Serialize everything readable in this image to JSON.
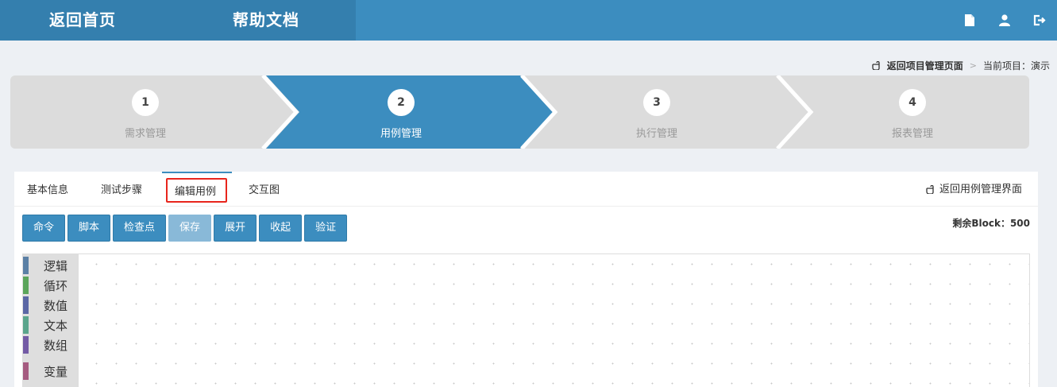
{
  "topbar": {
    "home": "返回首页",
    "help": "帮助文档",
    "icons": [
      "document-icon",
      "user-icon",
      "logout-icon"
    ]
  },
  "breadcrumb": {
    "back": "返回项目管理页面",
    "separator": ">",
    "current": "当前项目：演示"
  },
  "steps": [
    {
      "num": "1",
      "label": "需求管理",
      "active": false
    },
    {
      "num": "2",
      "label": "用例管理",
      "active": true
    },
    {
      "num": "3",
      "label": "执行管理",
      "active": false
    },
    {
      "num": "4",
      "label": "报表管理",
      "active": false
    }
  ],
  "tabs": {
    "items": [
      "基本信息",
      "测试步骤",
      "编辑用例",
      "交互图"
    ],
    "active": "编辑用例",
    "back": "返回用例管理界面"
  },
  "toolbar": {
    "buttons": [
      "命令",
      "脚本",
      "检查点",
      "保存",
      "展开",
      "收起",
      "验证"
    ],
    "disabled": "保存",
    "remaining": "剩余Block：500"
  },
  "palette": [
    {
      "name": "逻辑",
      "color": "#5b80a5"
    },
    {
      "name": "循环",
      "color": "#5ba55b"
    },
    {
      "name": "数值",
      "color": "#5b67a5"
    },
    {
      "name": "文本",
      "color": "#5ba58c"
    },
    {
      "name": "数组",
      "color": "#745ba5"
    },
    {
      "name": "变量",
      "color": "#a55b80"
    }
  ],
  "colors": {
    "accent": "#3c8dbf",
    "highlight": "#e8251c"
  }
}
